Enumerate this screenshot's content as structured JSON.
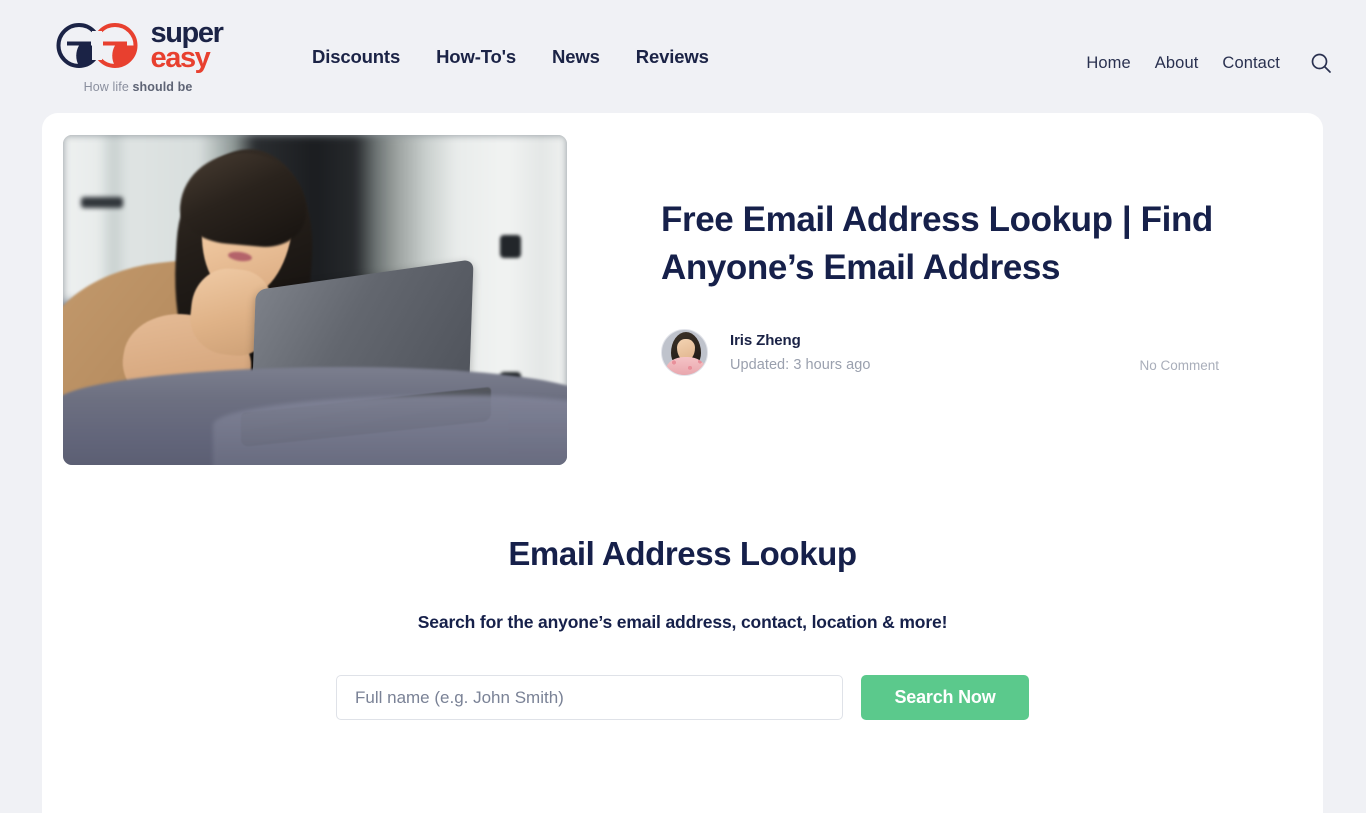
{
  "brand": {
    "logo_icon": "superEasy-double-e-logo",
    "name_top": "super",
    "name_bottom": "easy",
    "tagline_light": "How life ",
    "tagline_bold": "should be"
  },
  "nav": {
    "main": [
      {
        "label": "Discounts"
      },
      {
        "label": "How-To's"
      },
      {
        "label": "News"
      },
      {
        "label": "Reviews"
      }
    ],
    "right": [
      {
        "label": "Home"
      },
      {
        "label": "About"
      },
      {
        "label": "Contact"
      }
    ],
    "search_icon": "search-icon"
  },
  "hero": {
    "image_alt": "woman-lying-on-bed-using-laptop",
    "title": "Free Email Address Lookup | Find Anyone’s Email Address",
    "author": {
      "avatar_alt": "iris-zheng-avatar",
      "name": "Iris Zheng",
      "updated": "Updated: 3 hours ago"
    },
    "comments": "No Comment"
  },
  "lookup": {
    "title": "Email Address Lookup",
    "subtitle": "Search for the anyone’s email address, contact, location & more!",
    "input_value": "",
    "input_placeholder": "Full name (e.g. John Smith)",
    "button_label": "Search Now"
  },
  "colors": {
    "page_background": "#F0F1F5",
    "card_background": "#FFFFFF",
    "navy": "#16204A",
    "logo_red": "#E8402F",
    "accent_green": "#5BC98C",
    "muted_text": "#9AA0AE"
  }
}
